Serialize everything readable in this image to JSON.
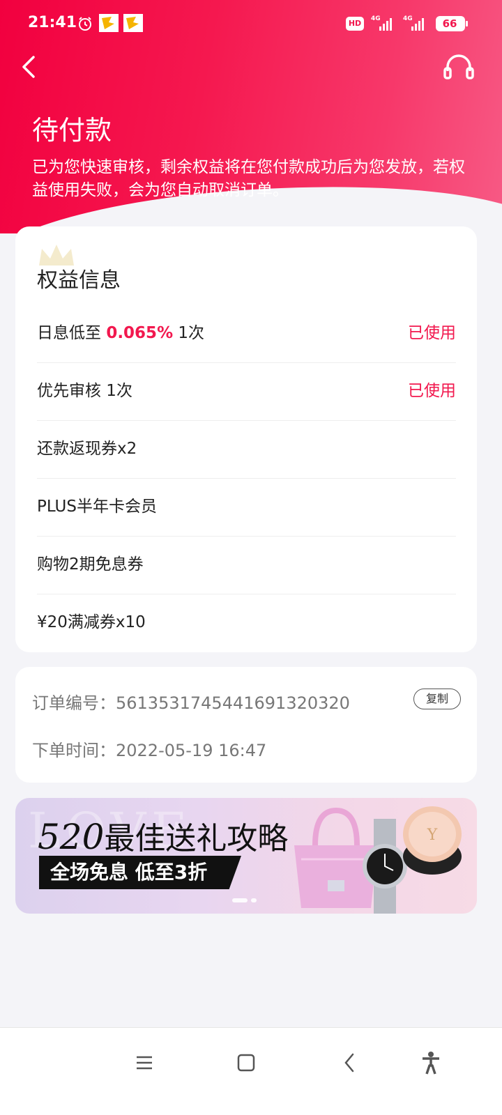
{
  "status_bar": {
    "time": "21:41",
    "hd": "HD",
    "signal1": "4G",
    "signal2": "4G",
    "battery": "66"
  },
  "header": {
    "title": "待付款",
    "description": "已为您快速审核，剩余权益将在您付款成功后为您发放，若权益使用失败，会为您自动取消订单。"
  },
  "benefits": {
    "title": "权益信息",
    "items": [
      {
        "label_prefix": "日息低至 ",
        "highlight": "0.065%",
        "label_suffix": "  1次",
        "status": "已使用"
      },
      {
        "label_prefix": "优先审核   1次",
        "highlight": "",
        "label_suffix": "",
        "status": "已使用"
      },
      {
        "label_prefix": "还款返现券x2",
        "highlight": "",
        "label_suffix": "",
        "status": ""
      },
      {
        "label_prefix": "PLUS半年卡会员",
        "highlight": "",
        "label_suffix": "",
        "status": ""
      },
      {
        "label_prefix": "购物2期免息券",
        "highlight": "",
        "label_suffix": "",
        "status": ""
      },
      {
        "label_prefix": "¥20满减券x10",
        "highlight": "",
        "label_suffix": "",
        "status": ""
      }
    ]
  },
  "order": {
    "number_label": "订单编号：",
    "number": "5613531745441691320320",
    "copy_label": "复制",
    "time_label": "下单时间：",
    "time": "2022-05-19 16:47"
  },
  "banner": {
    "ghost_text": "LOVE",
    "title_num": "520",
    "title": "最佳送礼攻略",
    "subtitle": "全场免息  低至3折"
  },
  "colors": {
    "accent": "#f2184e",
    "background": "#f4f4f8"
  },
  "bottom_nav": [
    "menu-icon",
    "home-icon",
    "back-icon",
    "accessibility-icon"
  ]
}
